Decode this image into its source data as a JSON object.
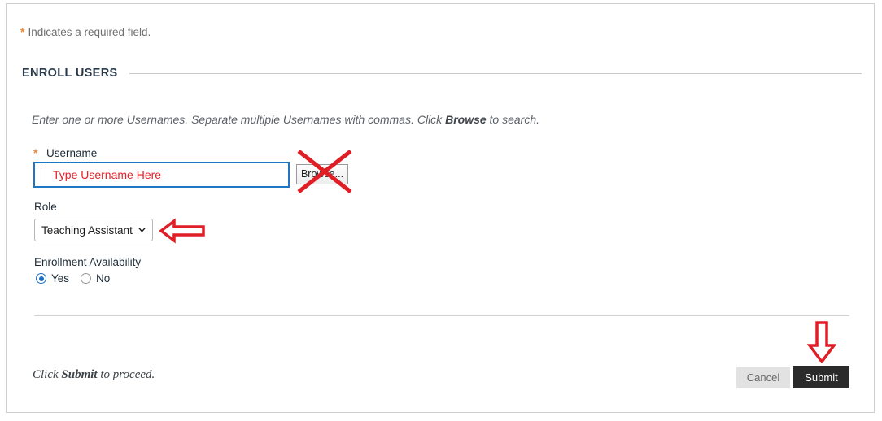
{
  "page": {
    "required_note_star": "*",
    "required_note_text": "Indicates a required field."
  },
  "section": {
    "heading": "ENROLL USERS",
    "instructions_part1": "Enter one or more Usernames. Separate multiple Usernames with commas. Click ",
    "instructions_bold": "Browse",
    "instructions_part2": " to search."
  },
  "username_field": {
    "required_star": "*",
    "label": "Username",
    "value": "",
    "placeholder": "Type Username Here",
    "browse_label": "Browse..."
  },
  "role_field": {
    "label": "Role",
    "selected": "Teaching Assistant",
    "options": [
      "Teaching Assistant"
    ]
  },
  "enrollment_field": {
    "label": "Enrollment Availability",
    "yes_label": "Yes",
    "no_label": "No",
    "selected": "Yes"
  },
  "footer": {
    "note_part1": "Click ",
    "note_bold": "Submit",
    "note_part2": " to proceed.",
    "cancel_label": "Cancel",
    "submit_label": "Submit"
  },
  "colors": {
    "required_star": "#e8883a",
    "focus_border": "#1f77c4",
    "placeholder_red": "#e8202a",
    "annotation_red": "#e01e26",
    "submit_bg": "#2b2b2b",
    "cancel_bg": "#e2e2e2",
    "radio_blue": "#1a6fc4",
    "heading_text": "#2b3a4a"
  },
  "annotations": {
    "browse_cross": "red-cross-mark",
    "role_arrow": "red-left-arrow",
    "submit_arrow": "red-down-arrow"
  }
}
